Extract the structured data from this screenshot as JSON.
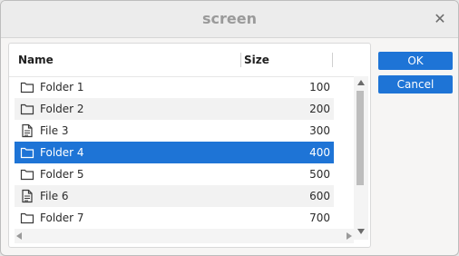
{
  "window": {
    "title": "screen"
  },
  "list": {
    "columns": {
      "name": "Name",
      "size": "Size"
    },
    "rows": [
      {
        "name": "Folder 1",
        "size": "100",
        "icon": "folder-icon",
        "selected": false
      },
      {
        "name": "Folder 2",
        "size": "200",
        "icon": "folder-icon",
        "selected": false
      },
      {
        "name": "File 3",
        "size": "300",
        "icon": "file-icon",
        "selected": false
      },
      {
        "name": "Folder 4",
        "size": "400",
        "icon": "folder-icon",
        "selected": true
      },
      {
        "name": "Folder 5",
        "size": "500",
        "icon": "folder-icon",
        "selected": false
      },
      {
        "name": "File 6",
        "size": "600",
        "icon": "file-icon",
        "selected": false
      },
      {
        "name": "Folder 7",
        "size": "700",
        "icon": "folder-icon",
        "selected": false
      }
    ]
  },
  "buttons": {
    "ok": "OK",
    "cancel": "Cancel"
  },
  "colors": {
    "selection": "#1e74d6",
    "title_text": "#9a9a9a"
  },
  "icons": {
    "close": "close-icon",
    "folder": "folder-icon",
    "file": "file-icon",
    "scroll_up": "up-arrow-icon",
    "scroll_down": "down-arrow-icon",
    "scroll_left": "left-arrow-icon",
    "scroll_right": "right-arrow-icon"
  }
}
